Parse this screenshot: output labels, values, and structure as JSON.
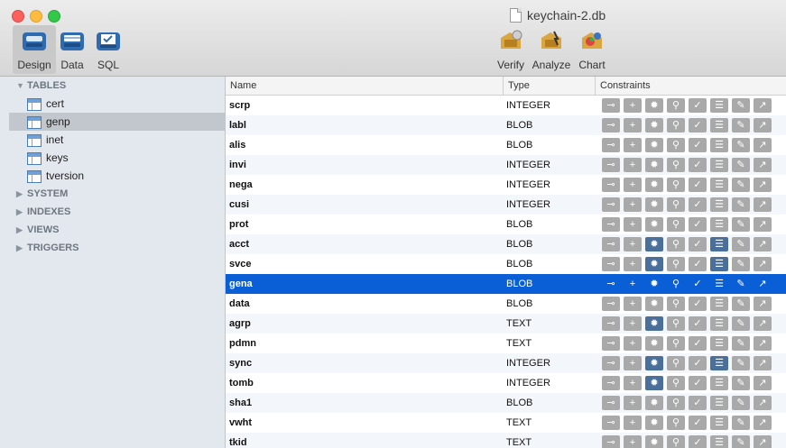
{
  "window": {
    "title": "keychain-2.db"
  },
  "toolbar": {
    "left": [
      {
        "label": "Design",
        "icon": "design-icon",
        "active": true
      },
      {
        "label": "Data",
        "icon": "data-icon",
        "active": false
      },
      {
        "label": "SQL",
        "icon": "sql-icon",
        "active": false
      }
    ],
    "right": [
      {
        "label": "Verify",
        "icon": "verify-icon"
      },
      {
        "label": "Analyze",
        "icon": "analyze-icon"
      },
      {
        "label": "Chart",
        "icon": "chart-icon"
      }
    ]
  },
  "sidebar": {
    "tables_header": "TABLES",
    "tables": [
      "cert",
      "genp",
      "inet",
      "keys",
      "tversion"
    ],
    "selected_table": "genp",
    "groups": [
      "SYSTEM",
      "INDEXES",
      "VIEWS",
      "TRIGGERS"
    ]
  },
  "grid": {
    "headers": {
      "name": "Name",
      "type": "Type",
      "constraints": "Constraints"
    },
    "rows": [
      {
        "name": "scrp",
        "type": "INTEGER"
      },
      {
        "name": "labl",
        "type": "BLOB"
      },
      {
        "name": "alis",
        "type": "BLOB"
      },
      {
        "name": "invi",
        "type": "INTEGER"
      },
      {
        "name": "nega",
        "type": "INTEGER"
      },
      {
        "name": "cusi",
        "type": "INTEGER"
      },
      {
        "name": "prot",
        "type": "BLOB"
      },
      {
        "name": "acct",
        "type": "BLOB"
      },
      {
        "name": "svce",
        "type": "BLOB"
      },
      {
        "name": "gena",
        "type": "BLOB"
      },
      {
        "name": "data",
        "type": "BLOB"
      },
      {
        "name": "agrp",
        "type": "TEXT"
      },
      {
        "name": "pdmn",
        "type": "TEXT"
      },
      {
        "name": "sync",
        "type": "INTEGER"
      },
      {
        "name": "tomb",
        "type": "INTEGER"
      },
      {
        "name": "sha1",
        "type": "BLOB"
      },
      {
        "name": "vwht",
        "type": "TEXT"
      },
      {
        "name": "tkid",
        "type": "TEXT"
      }
    ],
    "selected_row": "gena",
    "constraint_icons": [
      "key-icon",
      "plus-icon",
      "sun-icon",
      "pin-icon",
      "check-icon",
      "list-icon",
      "wrench-icon",
      "link-out-icon"
    ]
  }
}
